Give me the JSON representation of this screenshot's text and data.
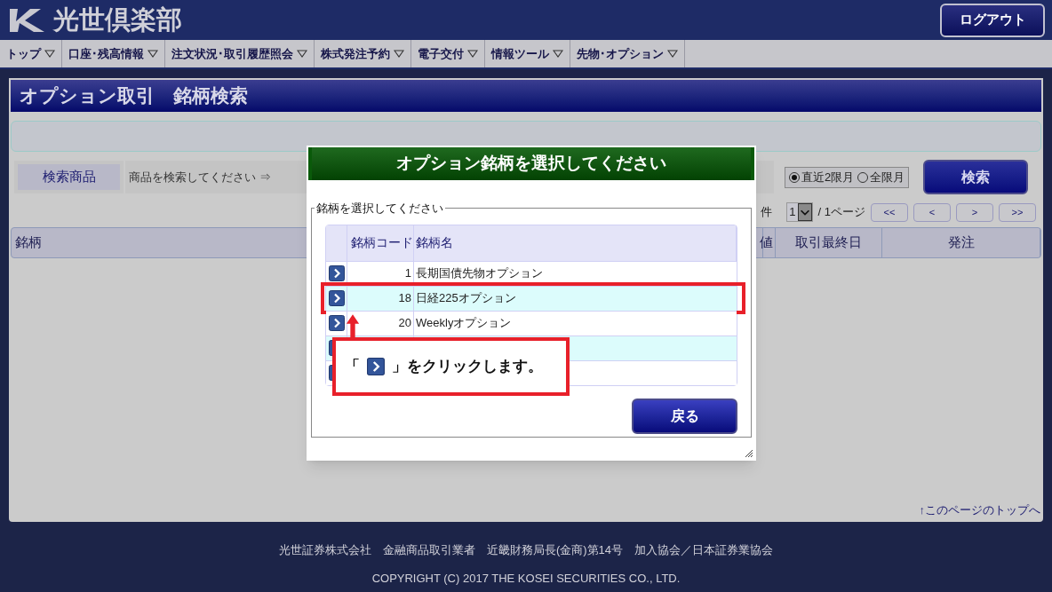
{
  "header": {
    "logo_text": "光世倶楽部",
    "logout": "ログアウト"
  },
  "nav": [
    "トップ",
    "口座･残高情報",
    "注文状況･取引履歴照会",
    "株式発注予約",
    "電子交付",
    "情報ツール",
    "先物･オプション"
  ],
  "page": {
    "title": "オプション取引　銘柄検索",
    "search": {
      "label": "検索商品",
      "hint": "商品を検索してください ⇒",
      "radios": [
        {
          "label": "直近2限月",
          "selected": true
        },
        {
          "label": "全限月",
          "selected": false
        }
      ],
      "button": "検索"
    },
    "pager": {
      "count_suffix": "件",
      "page_select": "1",
      "page_total": "/ 1ページ",
      "buttons": [
        "<<",
        "<",
        ">",
        ">>"
      ]
    },
    "columns": [
      "銘柄",
      "値",
      "取引最終日",
      "発注"
    ],
    "top_link": "↑このページのトップへ"
  },
  "modal": {
    "title": "オプション銘柄を選択してください",
    "legend": "銘柄を選択してください",
    "columns": [
      "銘柄コード",
      "銘柄名"
    ],
    "rows": [
      {
        "code": "1",
        "name": "長期国債先物オプション",
        "annotated": false
      },
      {
        "code": "18",
        "name": "日経225オプション",
        "annotated": true
      },
      {
        "code": "20",
        "name": "Weeklyオプション",
        "annotated": false
      },
      {
        "annotated": false
      },
      {
        "annotated": false
      }
    ],
    "back_button": "戻る"
  },
  "callout": {
    "before": "「",
    "after": "」をクリックします。"
  },
  "footer": [
    "光世証券株式会社　金融商品取引業者　近畿財務局長(金商)第14号　加入協会／日本証券業協会",
    "COPYRIGHT (C) 2017 THE KOSEI SECURITIES CO., LTD."
  ]
}
